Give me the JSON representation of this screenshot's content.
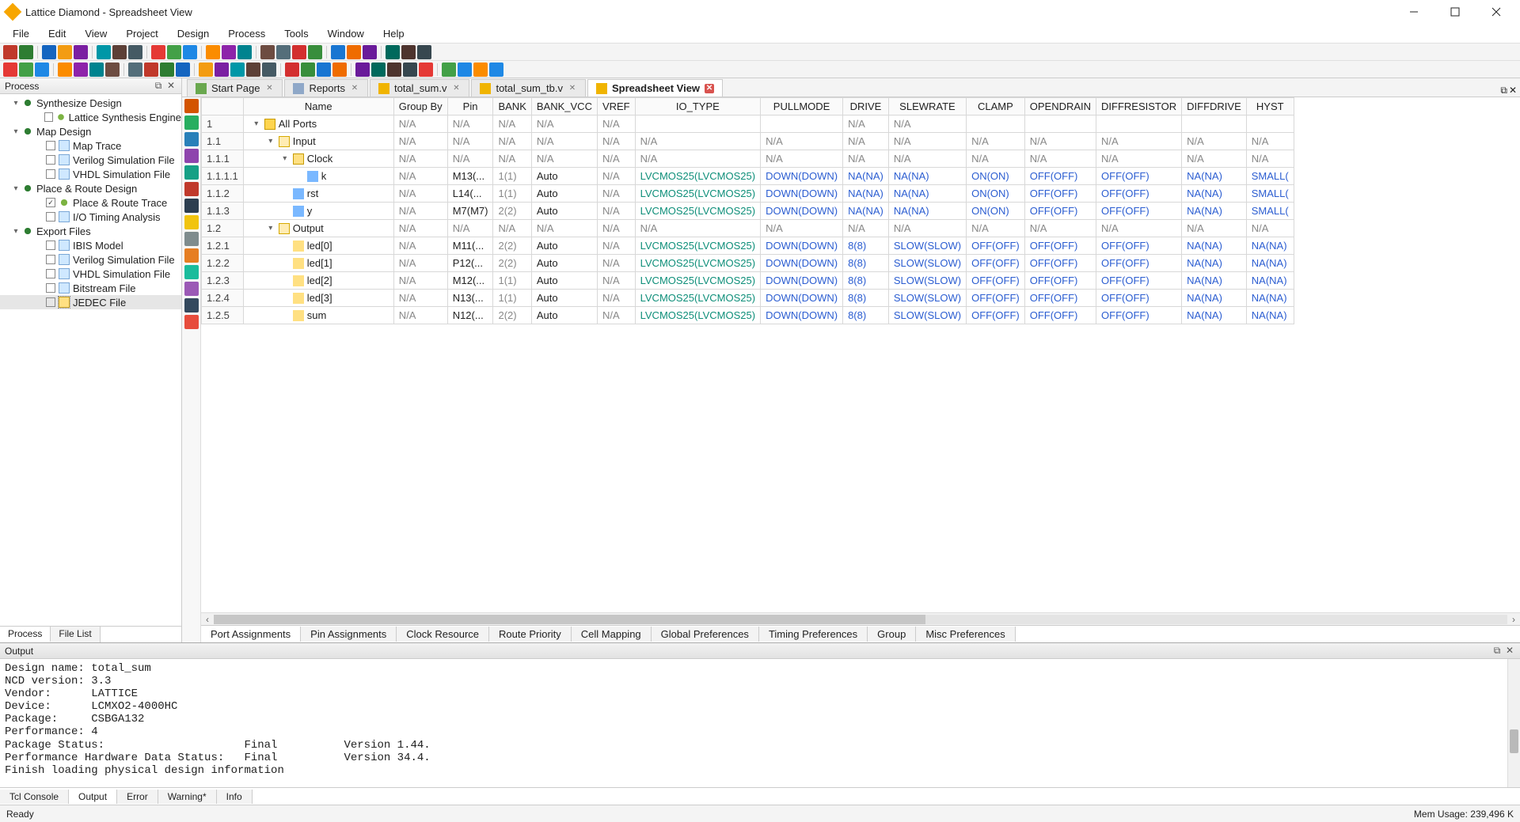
{
  "window": {
    "title": "Lattice Diamond - Spreadsheet View"
  },
  "menu": [
    "File",
    "Edit",
    "View",
    "Project",
    "Design",
    "Process",
    "Tools",
    "Window",
    "Help"
  ],
  "process_panel": {
    "title": "Process",
    "tabs": [
      "Process",
      "File List"
    ],
    "active_tab": 0,
    "nodes": [
      {
        "d": 1,
        "tw": "▾",
        "type": "arrows",
        "label": "Synthesize Design"
      },
      {
        "d": 2,
        "chk": "",
        "type": "light",
        "label": "Lattice Synthesis Engine"
      },
      {
        "d": 1,
        "tw": "▾",
        "type": "arrows",
        "label": "Map Design"
      },
      {
        "d": 2,
        "chk": "",
        "type": "file",
        "label": "Map Trace"
      },
      {
        "d": 2,
        "chk": "",
        "type": "file",
        "label": "Verilog Simulation File"
      },
      {
        "d": 2,
        "chk": "",
        "type": "file",
        "label": "VHDL Simulation File"
      },
      {
        "d": 1,
        "tw": "▾",
        "type": "arrows",
        "label": "Place & Route Design"
      },
      {
        "d": 2,
        "chk": "✓",
        "type": "light",
        "label": "Place & Route Trace"
      },
      {
        "d": 2,
        "chk": "",
        "type": "file",
        "label": "I/O Timing Analysis"
      },
      {
        "d": 1,
        "tw": "▾",
        "type": "arrows",
        "label": "Export Files"
      },
      {
        "d": 2,
        "chk": "",
        "type": "file",
        "label": "IBIS Model"
      },
      {
        "d": 2,
        "chk": "",
        "type": "file",
        "label": "Verilog Simulation File"
      },
      {
        "d": 2,
        "chk": "",
        "type": "file",
        "label": "VHDL Simulation File"
      },
      {
        "d": 2,
        "chk": "",
        "type": "file",
        "label": "Bitstream File"
      },
      {
        "d": 2,
        "chk": "",
        "type": "book",
        "label": "JEDEC File",
        "selected": true
      }
    ]
  },
  "editor_tabs": [
    {
      "label": "Start Page",
      "icon": "#6aa84f"
    },
    {
      "label": "Reports",
      "icon": "#8fa8c8"
    },
    {
      "label": "total_sum.v",
      "icon": "#f0b400"
    },
    {
      "label": "total_sum_tb.v",
      "icon": "#f0b400"
    },
    {
      "label": "Spreadsheet View",
      "icon": "#f0b400",
      "active": true
    }
  ],
  "spreadsheet": {
    "columns": [
      "Name",
      "Group By",
      "Pin",
      "BANK",
      "BANK_VCC",
      "VREF",
      "IO_TYPE",
      "PULLMODE",
      "DRIVE",
      "SLEWRATE",
      "CLAMP",
      "OPENDRAIN",
      "DIFFRESISTOR",
      "DIFFDRIVE",
      "HYST"
    ],
    "rows": [
      {
        "num": "1",
        "name": "All Ports",
        "indent": 0,
        "tw": "▾",
        "ico": "port",
        "cells": [
          "N/A",
          "N/A",
          "N/A",
          "N/A",
          "N/A",
          "",
          "",
          "N/A",
          "N/A",
          "",
          "",
          "",
          "",
          ""
        ],
        "cls": [
          "m",
          "m",
          "m",
          "m",
          "m",
          "",
          "",
          "m",
          "m",
          "",
          "",
          "",
          "",
          ""
        ]
      },
      {
        "num": "1.1",
        "name": "Input",
        "indent": 1,
        "tw": "▾",
        "ico": "dir",
        "cells": [
          "N/A",
          "N/A",
          "N/A",
          "N/A",
          "N/A",
          "N/A",
          "N/A",
          "N/A",
          "N/A",
          "N/A",
          "N/A",
          "N/A",
          "N/A",
          "N/A"
        ],
        "cls": [
          "m",
          "m",
          "m",
          "m",
          "m",
          "m",
          "m",
          "m",
          "m",
          "m",
          "m",
          "m",
          "m",
          "m"
        ]
      },
      {
        "num": "1.1.1",
        "name": "Clock",
        "indent": 2,
        "tw": "▾",
        "ico": "clock",
        "cells": [
          "N/A",
          "N/A",
          "N/A",
          "N/A",
          "N/A",
          "N/A",
          "N/A",
          "N/A",
          "N/A",
          "N/A",
          "N/A",
          "N/A",
          "N/A",
          "N/A"
        ],
        "cls": [
          "m",
          "m",
          "m",
          "m",
          "m",
          "m",
          "m",
          "m",
          "m",
          "m",
          "m",
          "m",
          "m",
          "m"
        ]
      },
      {
        "num": "1.1.1.1",
        "name": "k",
        "indent": 3,
        "ico": "sig-in",
        "cells": [
          "N/A",
          "M13(...",
          "1(1)",
          "Auto",
          "N/A",
          "LVCMOS25(LVCMOS25)",
          "DOWN(DOWN)",
          "NA(NA)",
          "NA(NA)",
          "ON(ON)",
          "OFF(OFF)",
          "OFF(OFF)",
          "NA(NA)",
          "SMALL("
        ],
        "cls": [
          "m",
          "",
          "m",
          "",
          "m",
          "t",
          "b",
          "b",
          "b",
          "b",
          "b",
          "b",
          "b",
          "b"
        ]
      },
      {
        "num": "1.1.2",
        "name": "rst",
        "indent": 2,
        "ico": "sig-in",
        "cells": [
          "N/A",
          "L14(...",
          "1(1)",
          "Auto",
          "N/A",
          "LVCMOS25(LVCMOS25)",
          "DOWN(DOWN)",
          "NA(NA)",
          "NA(NA)",
          "ON(ON)",
          "OFF(OFF)",
          "OFF(OFF)",
          "NA(NA)",
          "SMALL("
        ],
        "cls": [
          "m",
          "",
          "m",
          "",
          "m",
          "t",
          "b",
          "b",
          "b",
          "b",
          "b",
          "b",
          "b",
          "b"
        ]
      },
      {
        "num": "1.1.3",
        "name": "y",
        "indent": 2,
        "ico": "sig-in",
        "cells": [
          "N/A",
          "M7(M7)",
          "2(2)",
          "Auto",
          "N/A",
          "LVCMOS25(LVCMOS25)",
          "DOWN(DOWN)",
          "NA(NA)",
          "NA(NA)",
          "ON(ON)",
          "OFF(OFF)",
          "OFF(OFF)",
          "NA(NA)",
          "SMALL("
        ],
        "cls": [
          "m",
          "",
          "m",
          "",
          "m",
          "t",
          "b",
          "b",
          "b",
          "b",
          "b",
          "b",
          "b",
          "b"
        ]
      },
      {
        "num": "1.2",
        "name": "Output",
        "indent": 1,
        "tw": "▾",
        "ico": "dir",
        "cells": [
          "N/A",
          "N/A",
          "N/A",
          "N/A",
          "N/A",
          "N/A",
          "N/A",
          "N/A",
          "N/A",
          "N/A",
          "N/A",
          "N/A",
          "N/A",
          "N/A"
        ],
        "cls": [
          "m",
          "m",
          "m",
          "m",
          "m",
          "m",
          "m",
          "m",
          "m",
          "m",
          "m",
          "m",
          "m",
          "m"
        ]
      },
      {
        "num": "1.2.1",
        "name": "led[0]",
        "indent": 2,
        "ico": "sig-out",
        "cells": [
          "N/A",
          "M11(...",
          "2(2)",
          "Auto",
          "N/A",
          "LVCMOS25(LVCMOS25)",
          "DOWN(DOWN)",
          "8(8)",
          "SLOW(SLOW)",
          "OFF(OFF)",
          "OFF(OFF)",
          "OFF(OFF)",
          "NA(NA)",
          "NA(NA)"
        ],
        "cls": [
          "m",
          "",
          "m",
          "",
          "m",
          "t",
          "b",
          "b",
          "b",
          "b",
          "b",
          "b",
          "b",
          "b"
        ]
      },
      {
        "num": "1.2.2",
        "name": "led[1]",
        "indent": 2,
        "ico": "sig-out",
        "cells": [
          "N/A",
          "P12(...",
          "2(2)",
          "Auto",
          "N/A",
          "LVCMOS25(LVCMOS25)",
          "DOWN(DOWN)",
          "8(8)",
          "SLOW(SLOW)",
          "OFF(OFF)",
          "OFF(OFF)",
          "OFF(OFF)",
          "NA(NA)",
          "NA(NA)"
        ],
        "cls": [
          "m",
          "",
          "m",
          "",
          "m",
          "t",
          "b",
          "b",
          "b",
          "b",
          "b",
          "b",
          "b",
          "b"
        ]
      },
      {
        "num": "1.2.3",
        "name": "led[2]",
        "indent": 2,
        "ico": "sig-out",
        "cells": [
          "N/A",
          "M12(...",
          "1(1)",
          "Auto",
          "N/A",
          "LVCMOS25(LVCMOS25)",
          "DOWN(DOWN)",
          "8(8)",
          "SLOW(SLOW)",
          "OFF(OFF)",
          "OFF(OFF)",
          "OFF(OFF)",
          "NA(NA)",
          "NA(NA)"
        ],
        "cls": [
          "m",
          "",
          "m",
          "",
          "m",
          "t",
          "b",
          "b",
          "b",
          "b",
          "b",
          "b",
          "b",
          "b"
        ]
      },
      {
        "num": "1.2.4",
        "name": "led[3]",
        "indent": 2,
        "ico": "sig-out",
        "cells": [
          "N/A",
          "N13(...",
          "1(1)",
          "Auto",
          "N/A",
          "LVCMOS25(LVCMOS25)",
          "DOWN(DOWN)",
          "8(8)",
          "SLOW(SLOW)",
          "OFF(OFF)",
          "OFF(OFF)",
          "OFF(OFF)",
          "NA(NA)",
          "NA(NA)"
        ],
        "cls": [
          "m",
          "",
          "m",
          "",
          "m",
          "t",
          "b",
          "b",
          "b",
          "b",
          "b",
          "b",
          "b",
          "b"
        ]
      },
      {
        "num": "1.2.5",
        "name": "sum",
        "indent": 2,
        "ico": "sig-out",
        "cells": [
          "N/A",
          "N12(...",
          "2(2)",
          "Auto",
          "N/A",
          "LVCMOS25(LVCMOS25)",
          "DOWN(DOWN)",
          "8(8)",
          "SLOW(SLOW)",
          "OFF(OFF)",
          "OFF(OFF)",
          "OFF(OFF)",
          "NA(NA)",
          "NA(NA)"
        ],
        "cls": [
          "m",
          "",
          "m",
          "",
          "m",
          "t",
          "b",
          "b",
          "b",
          "b",
          "b",
          "b",
          "b",
          "b"
        ]
      }
    ],
    "bottom_tabs": [
      "Port Assignments",
      "Pin Assignments",
      "Clock Resource",
      "Route Priority",
      "Cell Mapping",
      "Global Preferences",
      "Timing Preferences",
      "Group",
      "Misc Preferences"
    ],
    "active_bottom_tab": 0
  },
  "output_panel": {
    "title": "Output",
    "text": "Design name: total_sum\nNCD version: 3.3\nVendor:      LATTICE\nDevice:      LCMXO2-4000HC\nPackage:     CSBGA132\nPerformance: 4\nPackage Status:                     Final          Version 1.44.\nPerformance Hardware Data Status:   Final          Version 34.4.\nFinish loading physical design information",
    "tabs": [
      "Tcl Console",
      "Output",
      "Error",
      "Warning*",
      "Info"
    ],
    "active_tab": 1
  },
  "statusbar": {
    "left": "Ready",
    "right": "Mem Usage: 239,496 K"
  },
  "colors": {
    "toolbar_icons": [
      "#c0392b",
      "#2e7d32",
      "#1565c0",
      "#f39c12",
      "#7b1fa2",
      "#0097a7",
      "#5d4037",
      "#455a64",
      "#e53935",
      "#43a047",
      "#1e88e5",
      "#fb8c00",
      "#8e24aa",
      "#00838f",
      "#6d4c41",
      "#546e7a",
      "#d32f2f",
      "#388e3c",
      "#1976d2",
      "#ef6c00",
      "#6a1b9a",
      "#00695c",
      "#4e342e",
      "#37474f"
    ],
    "toolbar_icons2": [
      "#e53935",
      "#43a047",
      "#1e88e5",
      "#fb8c00",
      "#8e24aa",
      "#00838f",
      "#6d4c41",
      "#546e7a",
      "#c0392b",
      "#2e7d32",
      "#1565c0",
      "#f39c12",
      "#7b1fa2",
      "#0097a7",
      "#5d4037",
      "#455a64",
      "#d32f2f",
      "#388e3c",
      "#1976d2",
      "#ef6c00",
      "#6a1b9a",
      "#00695c",
      "#4e342e",
      "#37474f",
      "#e53935",
      "#43a047",
      "#1e88e5",
      "#fb8c00",
      "#1e88e5"
    ],
    "vstrip": [
      "#d35400",
      "#27ae60",
      "#2980b9",
      "#8e44ad",
      "#16a085",
      "#c0392b",
      "#2c3e50",
      "#f1c40f",
      "#7f8c8d",
      "#e67e22",
      "#1abc9c",
      "#9b59b6",
      "#34495e",
      "#e74c3c"
    ]
  }
}
